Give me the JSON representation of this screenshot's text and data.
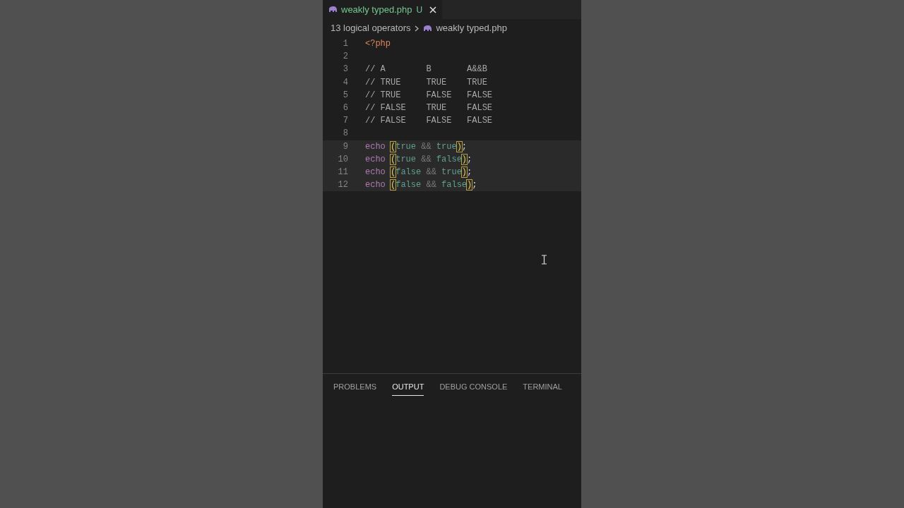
{
  "editor_tab": {
    "label": "weakly typed.php",
    "status": "U",
    "selected": true
  },
  "breadcrumb": {
    "folder": "13 logical operators",
    "file": "weakly typed.php"
  },
  "lines": [
    {
      "number": "1",
      "selected": false,
      "tokens": [
        {
          "kind": "tag",
          "text": "<?php"
        }
      ]
    },
    {
      "number": "2",
      "selected": false
    },
    {
      "number": "3",
      "selected": false,
      "tokens": [
        {
          "kind": "comment",
          "text": "// A        B       A&&B"
        }
      ]
    },
    {
      "number": "4",
      "selected": false,
      "tokens": [
        {
          "kind": "comment",
          "text": "// TRUE     TRUE    TRUE"
        }
      ]
    },
    {
      "number": "5",
      "selected": false,
      "tokens": [
        {
          "kind": "comment",
          "text": "// TRUE     FALSE   FALSE"
        }
      ]
    },
    {
      "number": "6",
      "selected": false,
      "tokens": [
        {
          "kind": "comment",
          "text": "// FALSE    TRUE    FALSE"
        }
      ]
    },
    {
      "number": "7",
      "selected": false,
      "tokens": [
        {
          "kind": "comment",
          "text": "// FALSE    FALSE   FALSE"
        }
      ]
    },
    {
      "number": "8",
      "selected": false
    },
    {
      "number": "9",
      "selected": true,
      "tokens": [
        {
          "kind": "keyword",
          "text": "echo "
        },
        {
          "kind": "bracket",
          "text": "("
        },
        {
          "kind": "constant",
          "text": "true"
        },
        {
          "kind": "operator",
          "text": " && "
        },
        {
          "kind": "constant",
          "text": "true"
        },
        {
          "kind": "bracket",
          "text": ")"
        },
        {
          "kind": "punct",
          "text": ";"
        }
      ]
    },
    {
      "number": "10",
      "selected": true,
      "tokens": [
        {
          "kind": "keyword",
          "text": "echo "
        },
        {
          "kind": "bracket",
          "text": "("
        },
        {
          "kind": "constant",
          "text": "true"
        },
        {
          "kind": "operator",
          "text": " && "
        },
        {
          "kind": "constant",
          "text": "false"
        },
        {
          "kind": "bracket",
          "text": ")"
        },
        {
          "kind": "punct",
          "text": ";"
        }
      ]
    },
    {
      "number": "11",
      "selected": true,
      "tokens": [
        {
          "kind": "keyword",
          "text": "echo "
        },
        {
          "kind": "bracket",
          "text": "("
        },
        {
          "kind": "constant",
          "text": "false"
        },
        {
          "kind": "operator",
          "text": " && "
        },
        {
          "kind": "constant",
          "text": "true"
        },
        {
          "kind": "bracket",
          "text": ")"
        },
        {
          "kind": "punct",
          "text": ";"
        }
      ]
    },
    {
      "number": "12",
      "selected": true,
      "tokens": [
        {
          "kind": "keyword",
          "text": "echo "
        },
        {
          "kind": "bracket",
          "text": "("
        },
        {
          "kind": "constant",
          "text": "false"
        },
        {
          "kind": "operator",
          "text": " && "
        },
        {
          "kind": "constant",
          "text": "false"
        },
        {
          "kind": "bracket",
          "text": ")"
        },
        {
          "kind": "punct",
          "text": ";"
        }
      ]
    }
  ],
  "panel_tabs": [
    {
      "label": "PROBLEMS",
      "selected": false
    },
    {
      "label": "OUTPUT",
      "selected": true
    },
    {
      "label": "DEBUG CONSOLE",
      "selected": false
    },
    {
      "label": "TERMINAL",
      "selected": false
    }
  ]
}
